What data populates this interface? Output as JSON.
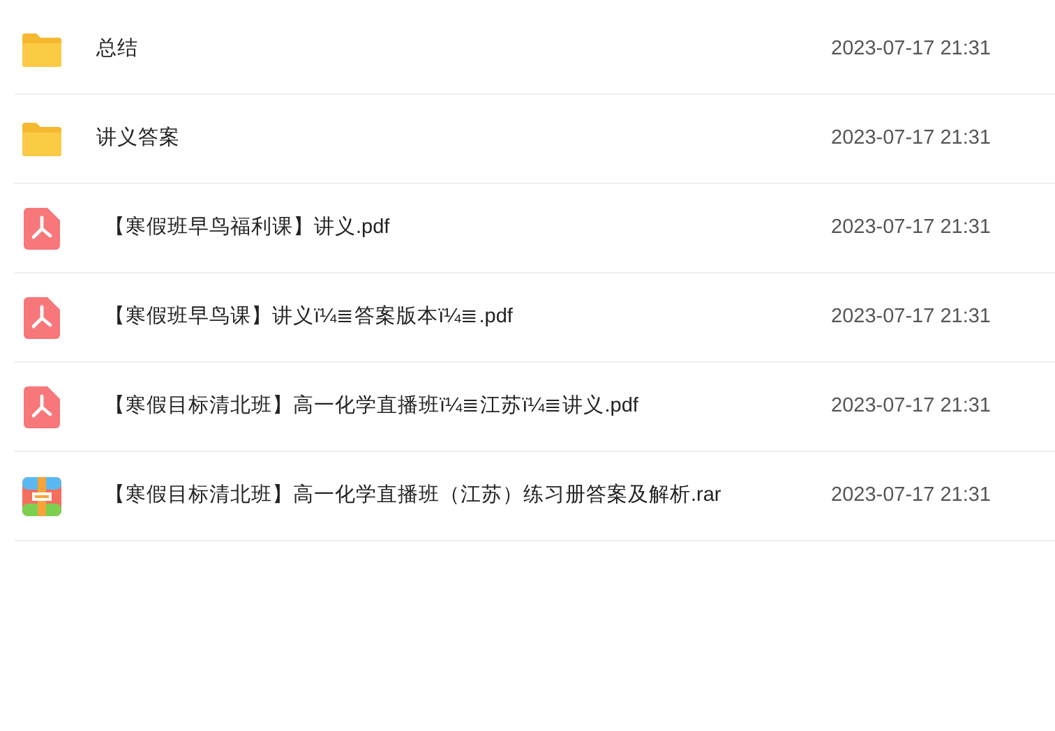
{
  "files": [
    {
      "kind": "folder",
      "name": "总结",
      "modified": "2023-07-17 21:31"
    },
    {
      "kind": "folder",
      "name": "讲义答案",
      "modified": "2023-07-17 21:31"
    },
    {
      "kind": "pdf",
      "name": "【寒假班早鸟福利课】讲义.pdf",
      "modified": "2023-07-17 21:31"
    },
    {
      "kind": "pdf",
      "name": "【寒假班早鸟课】讲义ï¼≣答案版本ï¼≣.pdf",
      "modified": "2023-07-17 21:31"
    },
    {
      "kind": "pdf",
      "name": "【寒假目标清北班】高一化学直播班ï¼≣江苏ï¼≣讲义.pdf",
      "modified": "2023-07-17 21:31"
    },
    {
      "kind": "archive",
      "name": "【寒假目标清北班】高一化学直播班（江苏）练习册答案及解析.rar",
      "modified": "2023-07-17 21:31"
    }
  ]
}
